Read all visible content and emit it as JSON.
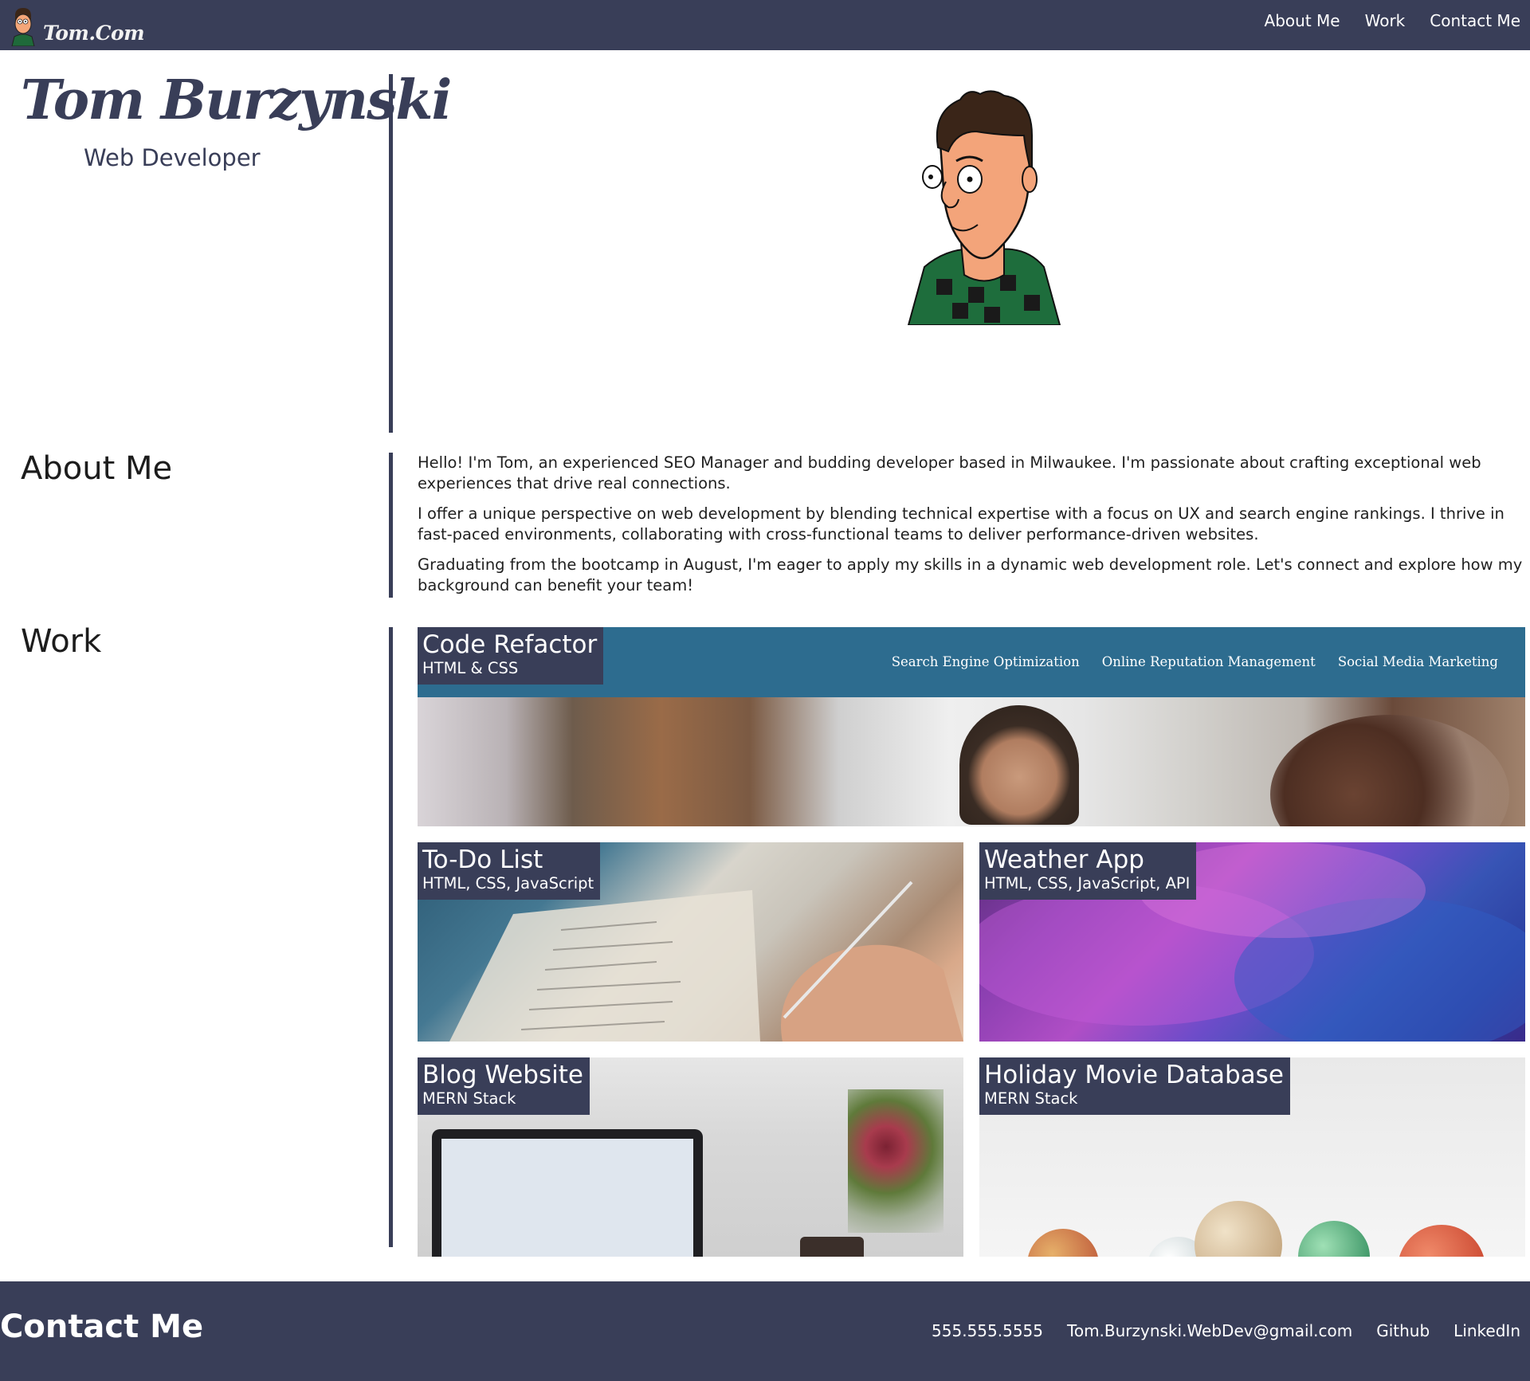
{
  "header": {
    "logo_text": "Tom.Com",
    "nav": [
      {
        "label": "About Me"
      },
      {
        "label": "Work"
      },
      {
        "label": "Contact Me"
      }
    ]
  },
  "intro": {
    "name": "Tom Burzynski",
    "role": "Web Developer"
  },
  "about": {
    "title": "About Me",
    "paragraphs": [
      "Hello! I'm Tom, an experienced SEO Manager and budding developer based in Milwaukee. I'm passionate about crafting exceptional web experiences that drive real connections.",
      "I offer a unique perspective on web development by blending technical expertise with a focus on UX and search engine rankings. I thrive in fast-paced environments, collaborating with cross-functional teams to deliver performance-driven websites.",
      "Graduating from the bootcamp in August, I'm eager to apply my skills in a dynamic web development role. Let's connect and explore how my background can benefit your team!"
    ]
  },
  "work": {
    "title": "Work",
    "projects": [
      {
        "title": "Code Refactor",
        "tech": "HTML & CSS",
        "nav": [
          "Search Engine Optimization",
          "Online Reputation Management",
          "Social Media Marketing"
        ]
      },
      {
        "title": "To-Do List",
        "tech": "HTML, CSS, JavaScript"
      },
      {
        "title": "Weather App",
        "tech": "HTML, CSS, JavaScript, API"
      },
      {
        "title": "Blog Website",
        "tech": "MERN Stack"
      },
      {
        "title": "Holiday Movie Database",
        "tech": "MERN Stack"
      }
    ]
  },
  "footer": {
    "title": "Contact Me",
    "links": [
      {
        "label": "555.555.5555"
      },
      {
        "label": "Tom.Burzynski.WebDev@gmail.com"
      },
      {
        "label": "Github"
      },
      {
        "label": "LinkedIn"
      }
    ]
  },
  "colors": {
    "primary": "#393e58",
    "card_header": "#2d6c8f",
    "background": "#ffffff"
  }
}
